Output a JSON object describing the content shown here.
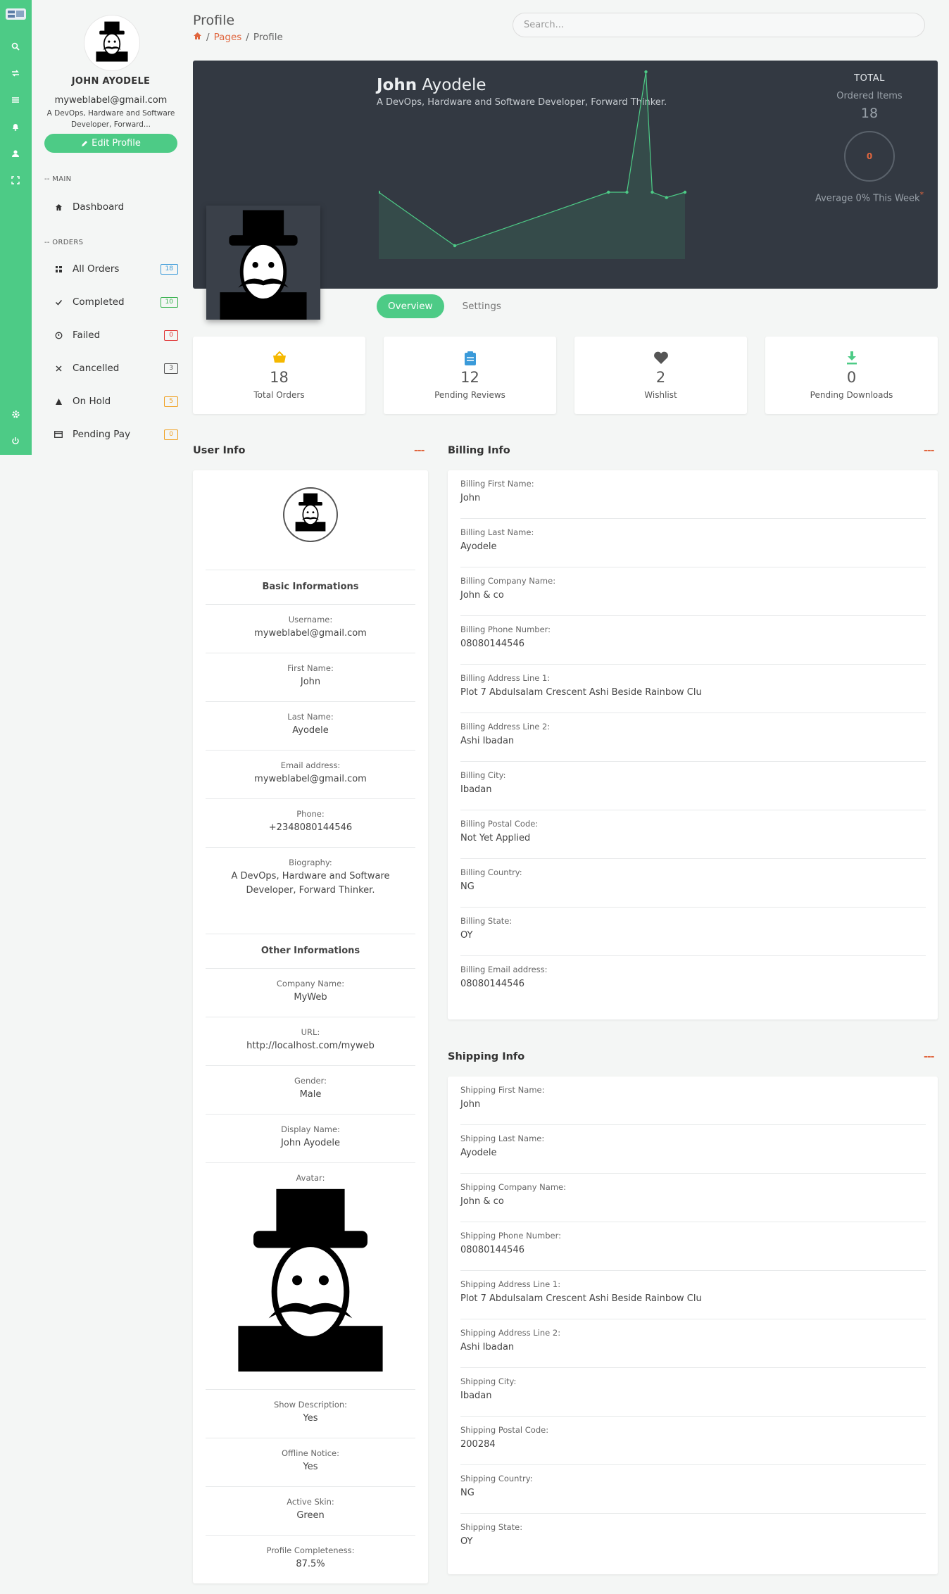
{
  "sidebar": {
    "name": "JOHN AYODELE",
    "email": "myweblabel@gmail.com",
    "bio": "A DevOps, Hardware and Software Developer, Forward...",
    "edit_label": "Edit Profile",
    "main_section": "-- MAIN",
    "orders_section": "-- ORDERS",
    "main_items": [
      {
        "label": "Dashboard",
        "icon": "home-icon"
      }
    ],
    "order_items": [
      {
        "label": "All Orders",
        "count": "18",
        "color": "#3a9ad9",
        "icon": "grid-icon"
      },
      {
        "label": "Completed",
        "count": "10",
        "color": "#37b24d",
        "icon": "check-icon"
      },
      {
        "label": "Failed",
        "count": "0",
        "color": "#e03131",
        "icon": "clock-icon"
      },
      {
        "label": "Cancelled",
        "count": "3",
        "color": "#555555",
        "icon": "close-icon"
      },
      {
        "label": "On Hold",
        "count": "5",
        "color": "#f0a020",
        "icon": "warning-icon"
      },
      {
        "label": "Pending Pay",
        "count": "0",
        "color": "#f0a020",
        "icon": "card-icon"
      }
    ]
  },
  "header": {
    "title": "Profile",
    "breadcrumb": [
      "Pages",
      "Profile"
    ],
    "search_placeholder": "Search..."
  },
  "hero": {
    "first_name": "John",
    "last_name": "Ayodele",
    "bio": "A DevOps, Hardware and Software Developer, Forward Thinker.",
    "total_label": "TOTAL",
    "ordered_label": "Ordered Items",
    "ordered_value": "18",
    "ring_value": "0",
    "average_label": "Average 0% This Week",
    "average_mark": "*"
  },
  "chart_data": {
    "type": "area",
    "series": [
      {
        "values": [
          5,
          1,
          5,
          5,
          14,
          5,
          4.6,
          5
        ]
      }
    ],
    "ylim": [
      0,
      14
    ]
  },
  "tabs": [
    "Overview",
    "Settings"
  ],
  "stats": [
    {
      "value": "18",
      "label": "Total Orders",
      "icon": "basket-icon",
      "color": "#f5b800"
    },
    {
      "value": "12",
      "label": "Pending Reviews",
      "icon": "clipboard-icon",
      "color": "#3a9ad9"
    },
    {
      "value": "2",
      "label": "Wishlist",
      "icon": "heart-icon",
      "color": "#555555"
    },
    {
      "value": "0",
      "label": "Pending Downloads",
      "icon": "download-icon",
      "color": "#4dcb86"
    }
  ],
  "user_info": {
    "title": "User Info",
    "dots": "---",
    "basic_heading": "Basic Informations",
    "other_heading": "Other Informations",
    "basic": [
      {
        "label": "Username:",
        "value": "myweblabel@gmail.com"
      },
      {
        "label": "First Name:",
        "value": "John"
      },
      {
        "label": "Last Name:",
        "value": "Ayodele"
      },
      {
        "label": "Email address:",
        "value": "myweblabel@gmail.com"
      },
      {
        "label": "Phone:",
        "value": "+2348080144546"
      },
      {
        "label": "Biography:",
        "value": "A DevOps, Hardware and Software Developer, Forward Thinker."
      }
    ],
    "other": [
      {
        "label": "Company Name:",
        "value": "MyWeb"
      },
      {
        "label": "URL:",
        "value": "http://localhost.com/myweb"
      },
      {
        "label": "Gender:",
        "value": "Male"
      },
      {
        "label": "Display Name:",
        "value": "John Ayodele"
      }
    ],
    "avatar_label": "Avatar:",
    "after": [
      {
        "label": "Show Description:",
        "value": "Yes"
      },
      {
        "label": "Offline Notice:",
        "value": "Yes"
      },
      {
        "label": "Active Skin:",
        "value": "Green"
      },
      {
        "label": "Profile Completeness:",
        "value": "87.5%"
      }
    ]
  },
  "billing": {
    "title": "Billing Info",
    "dots": "---",
    "rows": [
      {
        "label": "Billing First Name:",
        "value": "John"
      },
      {
        "label": "Billing Last Name:",
        "value": "Ayodele"
      },
      {
        "label": "Billing Company Name:",
        "value": "John & co"
      },
      {
        "label": "Billing Phone Number:",
        "value": "08080144546"
      },
      {
        "label": "Billing Address Line 1:",
        "value": "Plot 7 Abdulsalam Crescent Ashi Beside Rainbow Clu"
      },
      {
        "label": "Billing Address Line 2:",
        "value": "Ashi Ibadan"
      },
      {
        "label": "Billing City:",
        "value": "Ibadan"
      },
      {
        "label": "Billing Postal Code:",
        "value": "Not Yet Applied"
      },
      {
        "label": "Billing Country:",
        "value": "NG"
      },
      {
        "label": "Billing State:",
        "value": "OY"
      },
      {
        "label": "Billing Email address:",
        "value": "08080144546"
      }
    ]
  },
  "shipping": {
    "title": "Shipping Info",
    "dots": "---",
    "rows": [
      {
        "label": "Shipping First Name:",
        "value": "John"
      },
      {
        "label": "Shipping Last Name:",
        "value": "Ayodele"
      },
      {
        "label": "Shipping Company Name:",
        "value": "John & co"
      },
      {
        "label": "Shipping Phone Number:",
        "value": "08080144546"
      },
      {
        "label": "Shipping Address Line 1:",
        "value": "Plot 7 Abdulsalam Crescent Ashi Beside Rainbow Clu"
      },
      {
        "label": "Shipping Address Line 2:",
        "value": "Ashi Ibadan"
      },
      {
        "label": "Shipping City:",
        "value": "Ibadan"
      },
      {
        "label": "Shipping Postal Code:",
        "value": "200284"
      },
      {
        "label": "Shipping Country:",
        "value": "NG"
      },
      {
        "label": "Shipping State:",
        "value": "OY"
      }
    ]
  },
  "colors": {
    "accent": "#4dcb86",
    "link": "#e0663e",
    "hero_bg": "#333942"
  }
}
